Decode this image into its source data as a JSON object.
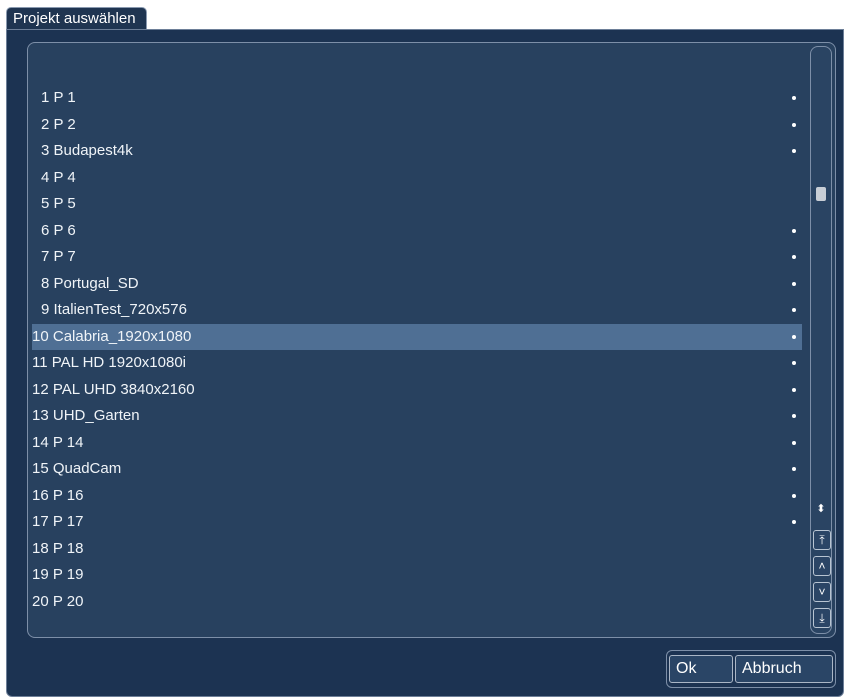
{
  "dialog": {
    "title": "Projekt auswählen"
  },
  "projects": [
    {
      "number": "1",
      "name": "P 1",
      "dot": true
    },
    {
      "number": "2",
      "name": "P 2",
      "dot": true
    },
    {
      "number": "3",
      "name": "Budapest4k",
      "dot": true
    },
    {
      "number": "4",
      "name": "P 4",
      "dot": false
    },
    {
      "number": "5",
      "name": "P 5",
      "dot": false
    },
    {
      "number": "6",
      "name": "P 6",
      "dot": true
    },
    {
      "number": "7",
      "name": "P 7",
      "dot": true
    },
    {
      "number": "8",
      "name": "Portugal_SD",
      "dot": true
    },
    {
      "number": "9",
      "name": "ItalienTest_720x576",
      "dot": true
    },
    {
      "number": "10",
      "name": "Calabria_1920x1080",
      "dot": true,
      "selected": true
    },
    {
      "number": "11",
      "name": "PAL HD 1920x1080i",
      "dot": true
    },
    {
      "number": "12",
      "name": "PAL UHD 3840x2160",
      "dot": true
    },
    {
      "number": "13",
      "name": "UHD_Garten",
      "dot": true
    },
    {
      "number": "14",
      "name": "P 14",
      "dot": true
    },
    {
      "number": "15",
      "name": "QuadCam",
      "dot": true
    },
    {
      "number": "16",
      "name": "P 16",
      "dot": true
    },
    {
      "number": "17",
      "name": "P 17",
      "dot": true
    },
    {
      "number": "18",
      "name": "P 18",
      "dot": false
    },
    {
      "number": "19",
      "name": "P 19",
      "dot": false
    },
    {
      "number": "20",
      "name": "P 20",
      "dot": false
    }
  ],
  "scrollbar": {
    "position": 0.2,
    "buttons": [
      {
        "icon": "updown-icon",
        "glyph": "⬍"
      },
      {
        "icon": "scroll-to-top-icon",
        "glyph": "⤒"
      },
      {
        "icon": "scroll-up-icon",
        "glyph": "˄"
      },
      {
        "icon": "scroll-down-icon",
        "glyph": "˅"
      },
      {
        "icon": "scroll-to-bottom-icon",
        "glyph": "⤓"
      }
    ]
  },
  "buttons": {
    "ok_label": "Ok",
    "cancel_label": "Abbruch"
  },
  "colors": {
    "background": "#1c3352",
    "panel": "#28415f",
    "selection": "#4f6f94",
    "text": "#f0f4f8"
  }
}
